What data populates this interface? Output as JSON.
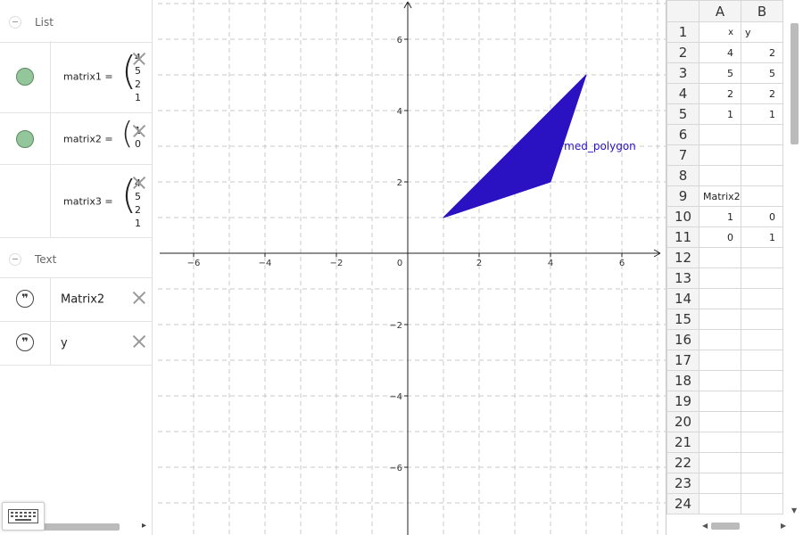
{
  "algebra": {
    "groups": [
      {
        "label": "List"
      },
      {
        "label": "Text"
      }
    ],
    "matrices": [
      {
        "label": "matrix1 =",
        "values": [
          "4",
          "5",
          "2",
          "1"
        ]
      },
      {
        "label": "matrix2 =",
        "values": [
          "1",
          "0"
        ]
      },
      {
        "label": "matrix3 =",
        "values": [
          "4",
          "5",
          "2",
          "1"
        ]
      }
    ],
    "texts": [
      {
        "value": "Matrix2"
      },
      {
        "value": "y"
      }
    ]
  },
  "graphics": {
    "x_ticks": [
      "−6",
      "−4",
      "−2",
      "0",
      "2",
      "4",
      "6"
    ],
    "y_ticks": [
      "6",
      "4",
      "2",
      "−2",
      "−4",
      "−6"
    ],
    "polygon_label": "transformed_polygon",
    "polygon_color": "#2a12c2",
    "polygon_points": [
      [
        1,
        1
      ],
      [
        5,
        5
      ],
      [
        4,
        2
      ]
    ]
  },
  "spreadsheet": {
    "columns": [
      "A",
      "B"
    ],
    "rows": [
      {
        "n": "1",
        "a": "x",
        "b": "y"
      },
      {
        "n": "2",
        "a": "4",
        "b": "2"
      },
      {
        "n": "3",
        "a": "5",
        "b": "5"
      },
      {
        "n": "4",
        "a": "2",
        "b": "2"
      },
      {
        "n": "5",
        "a": "1",
        "b": "1"
      },
      {
        "n": "6",
        "a": "",
        "b": ""
      },
      {
        "n": "7",
        "a": "",
        "b": ""
      },
      {
        "n": "8",
        "a": "",
        "b": ""
      },
      {
        "n": "9",
        "a": "Matrix2",
        "b": ""
      },
      {
        "n": "10",
        "a": "1",
        "b": "0"
      },
      {
        "n": "11",
        "a": "0",
        "b": "1"
      },
      {
        "n": "12",
        "a": "",
        "b": ""
      },
      {
        "n": "13",
        "a": "",
        "b": ""
      },
      {
        "n": "14",
        "a": "",
        "b": ""
      },
      {
        "n": "15",
        "a": "",
        "b": ""
      },
      {
        "n": "16",
        "a": "",
        "b": ""
      },
      {
        "n": "17",
        "a": "",
        "b": ""
      },
      {
        "n": "18",
        "a": "",
        "b": ""
      },
      {
        "n": "19",
        "a": "",
        "b": ""
      },
      {
        "n": "20",
        "a": "",
        "b": ""
      },
      {
        "n": "21",
        "a": "",
        "b": ""
      },
      {
        "n": "22",
        "a": "",
        "b": ""
      },
      {
        "n": "23",
        "a": "",
        "b": ""
      },
      {
        "n": "24",
        "a": "",
        "b": ""
      }
    ]
  },
  "icons": {
    "keyboard": "keyboard-icon",
    "delete": "close-icon",
    "text": "quote-icon",
    "visibility": "marble-icon"
  }
}
